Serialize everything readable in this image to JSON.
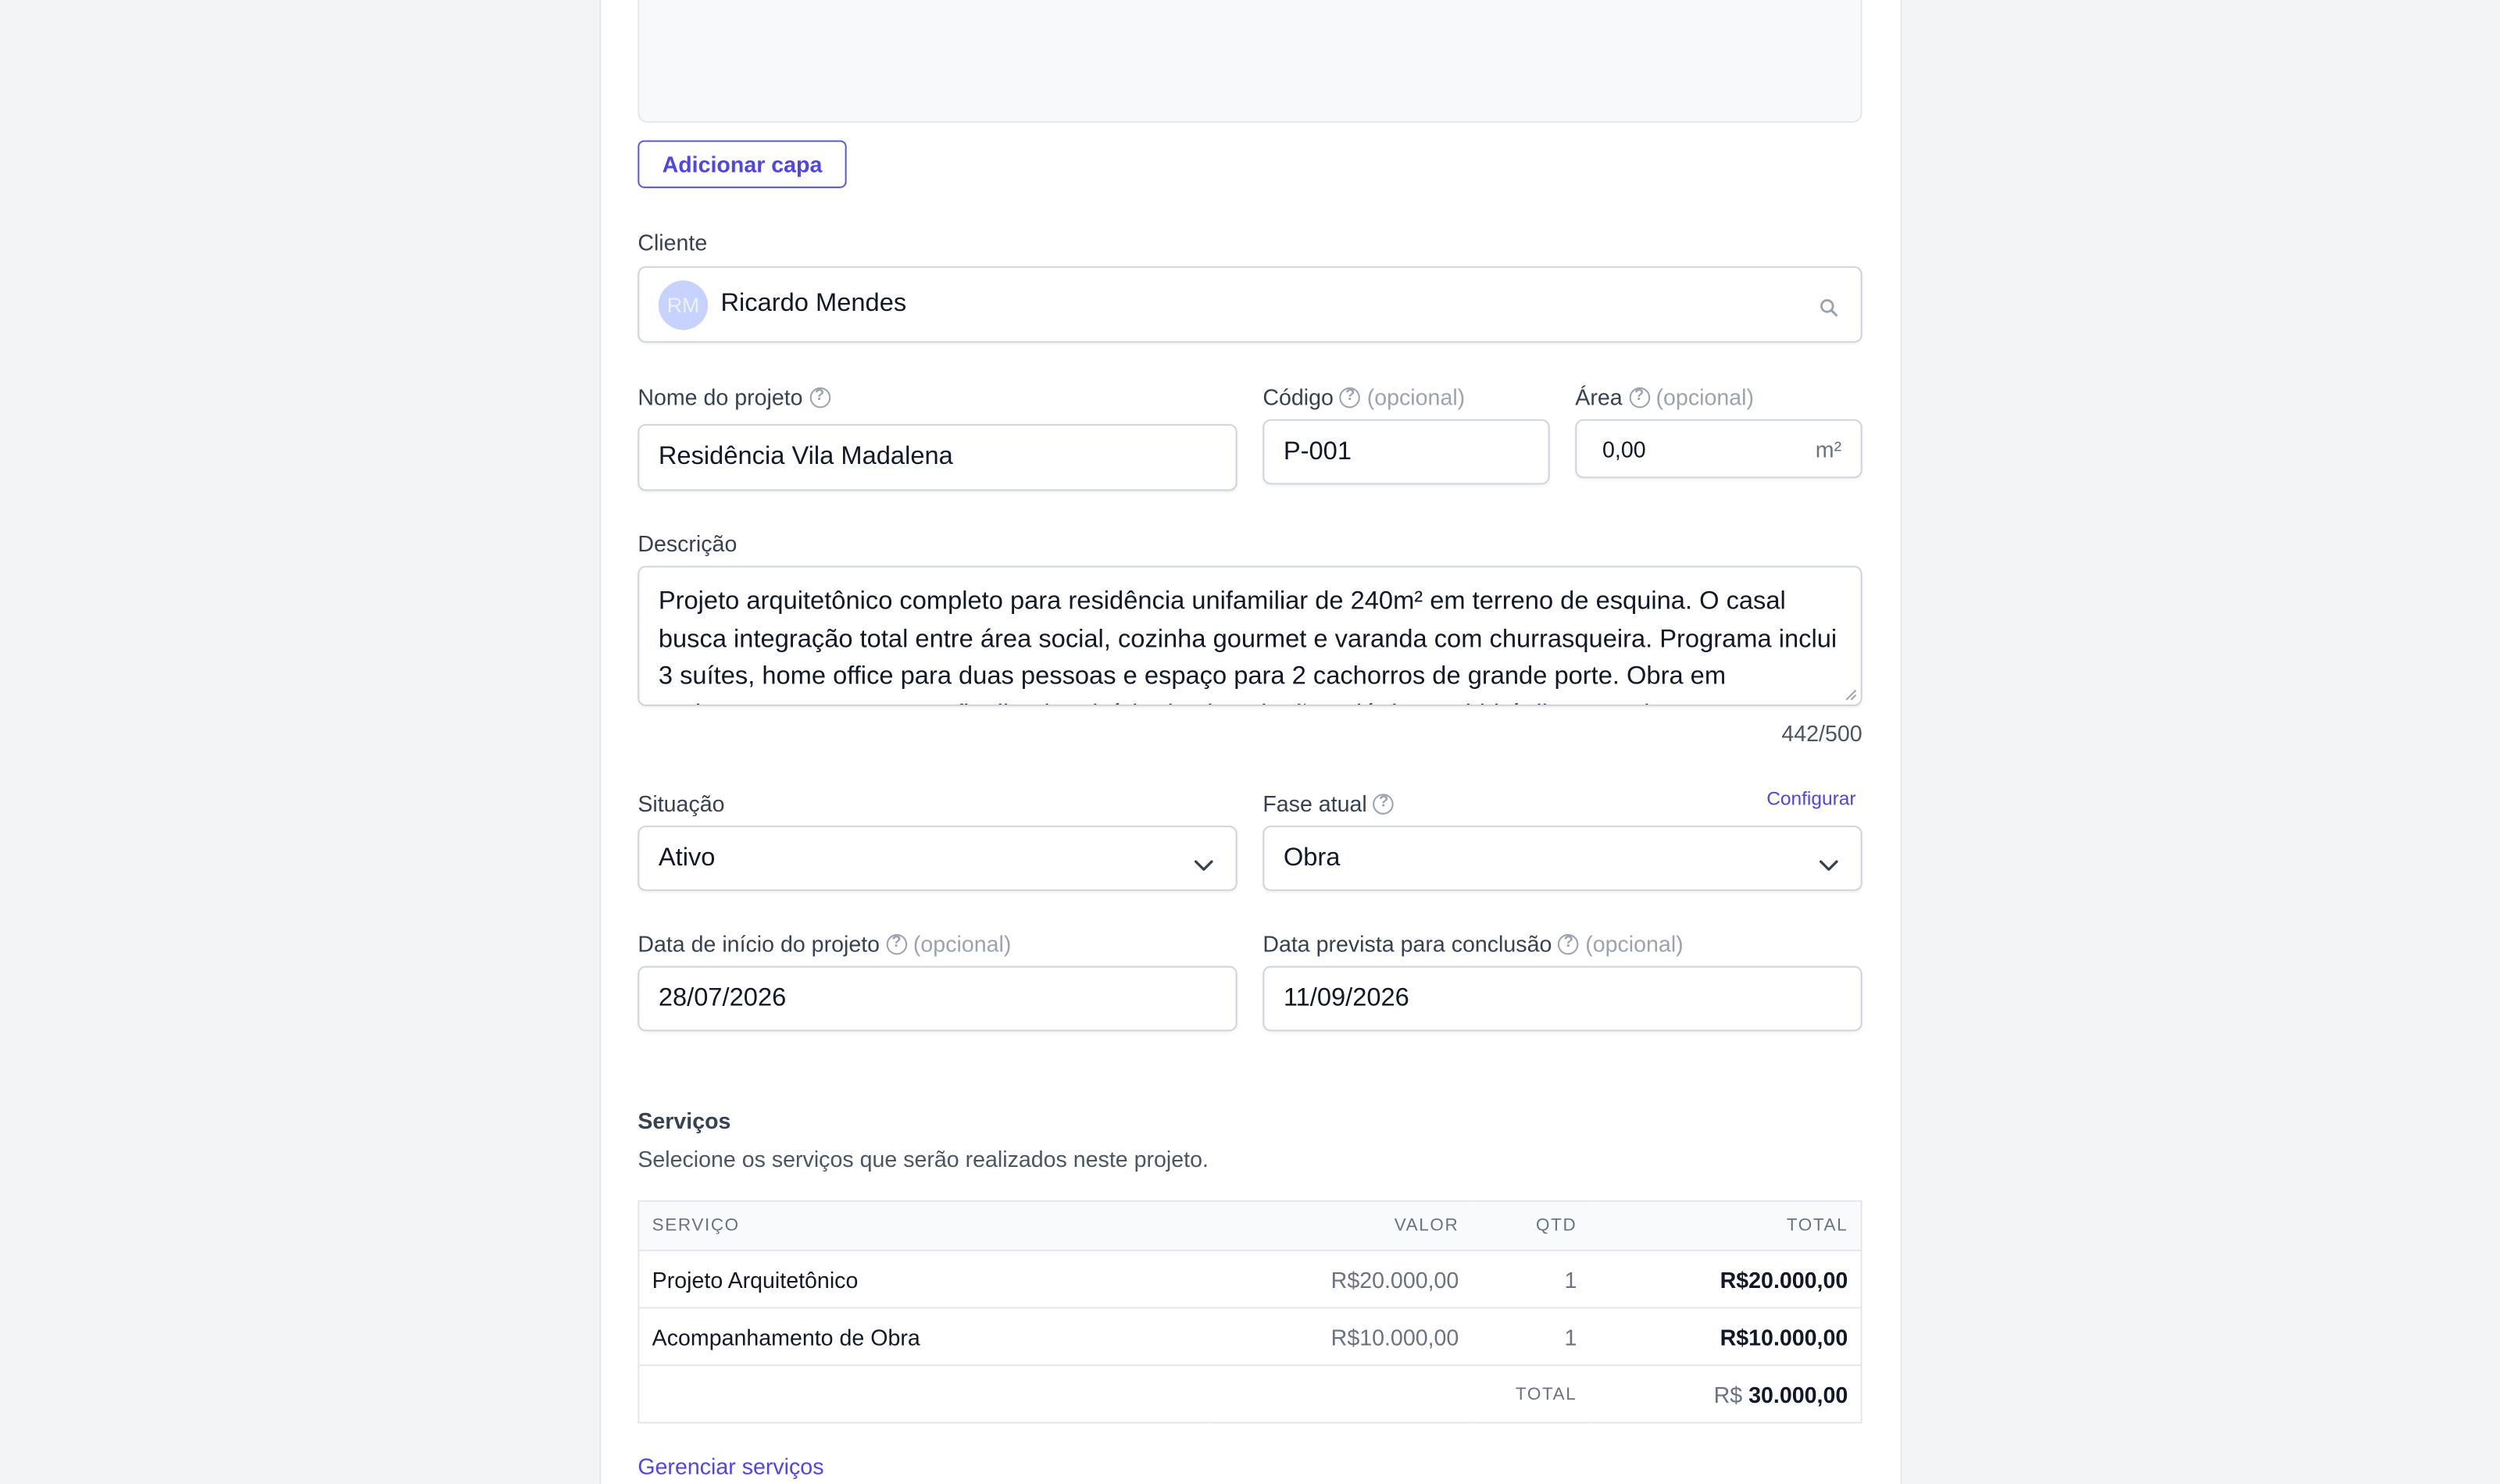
{
  "cover": {
    "button_label": "Adicionar capa"
  },
  "client": {
    "label": "Cliente",
    "avatar_initials": "RM",
    "name": "Ricardo Mendes",
    "icon": "search-icon"
  },
  "project_name": {
    "label": "Nome do projeto",
    "value": "Residência Vila Madalena"
  },
  "code": {
    "label": "Código",
    "optional": "(opcional)",
    "value": "P-001"
  },
  "area": {
    "label": "Área",
    "optional": "(opcional)",
    "value": "0,00",
    "unit": "m²"
  },
  "description": {
    "label": "Descrição",
    "value": "Projeto arquitetônico completo para residência unifamiliar de 240m² em terreno de esquina. O casal busca integração total entre área social, cozinha gourmet e varanda com churrasqueira. Programa inclui 3 suítes, home office para duas pessoas e espaço para 2 cachorros de grande porte. Obra em andamento com estrutura finalizada e início das instalações elétricas e hidráulicas previsto para o próximo mês.",
    "counter": "442/500"
  },
  "status": {
    "label": "Situação",
    "value": "Ativo"
  },
  "phase": {
    "label": "Fase atual",
    "value": "Obra",
    "configure_link": "Configurar"
  },
  "start_date": {
    "label": "Data de início do projeto",
    "optional": "(opcional)",
    "value": "28/07/2026"
  },
  "end_date": {
    "label": "Data prevista para conclusão",
    "optional": "(opcional)",
    "value": "11/09/2026"
  },
  "services": {
    "title": "Serviços",
    "subtitle": "Selecione os serviços que serão realizados neste projeto.",
    "headers": {
      "service": "SERVIÇO",
      "value": "VALOR",
      "qty": "QTD",
      "total": "TOTAL"
    },
    "rows": [
      {
        "service": "Projeto Arquitetônico",
        "value": "R$20.000,00",
        "qty": "1",
        "total": "R$20.000,00"
      },
      {
        "service": "Acompanhamento de Obra",
        "value": "R$10.000,00",
        "qty": "1",
        "total": "R$10.000,00"
      }
    ],
    "footer": {
      "label": "TOTAL",
      "currency": "R$",
      "amount": "30.000,00"
    },
    "manage_link": "Gerenciar serviços"
  },
  "colors": {
    "accent": "#4f46e5",
    "border": "#d1d5db",
    "background": "#f3f4f6"
  }
}
